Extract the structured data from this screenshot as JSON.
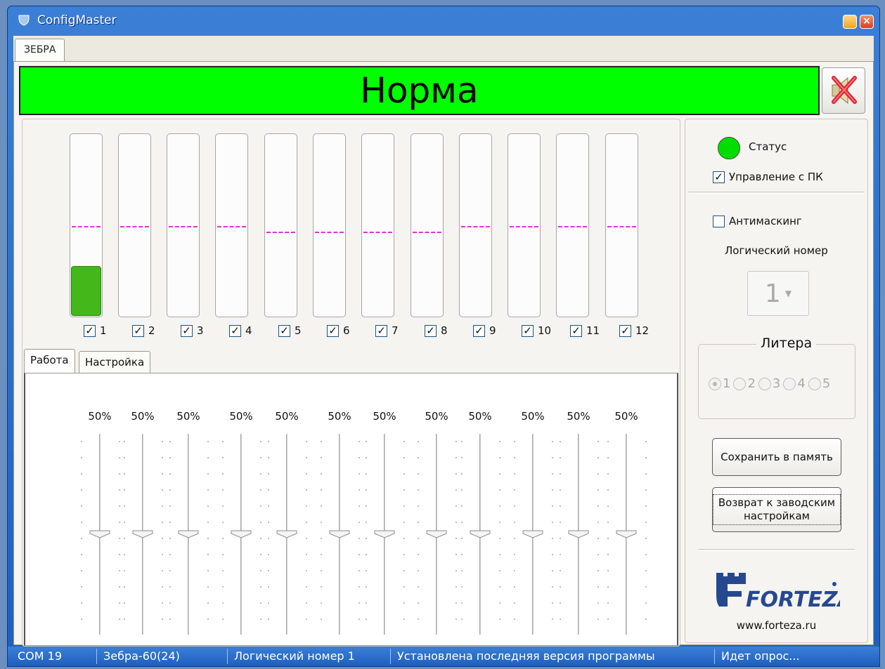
{
  "window": {
    "title": "ConfigMaster"
  },
  "outer_tab": {
    "label": "ЗЕБРА"
  },
  "banner": {
    "status_text": "Норма",
    "color": "#00ff00"
  },
  "channels": [
    {
      "label": "1",
      "checked": true,
      "level": 0.27,
      "threshold": 0.5
    },
    {
      "label": "2",
      "checked": true,
      "level": 0,
      "threshold": 0.5
    },
    {
      "label": "3",
      "checked": true,
      "level": 0,
      "threshold": 0.5
    },
    {
      "label": "4",
      "checked": true,
      "level": 0,
      "threshold": 0.5
    },
    {
      "label": "5",
      "checked": true,
      "level": 0,
      "threshold": 0.47
    },
    {
      "label": "6",
      "checked": true,
      "level": 0,
      "threshold": 0.47
    },
    {
      "label": "7",
      "checked": true,
      "level": 0,
      "threshold": 0.47
    },
    {
      "label": "8",
      "checked": true,
      "level": 0,
      "threshold": 0.47
    },
    {
      "label": "9",
      "checked": true,
      "level": 0,
      "threshold": 0.5
    },
    {
      "label": "10",
      "checked": true,
      "level": 0,
      "threshold": 0.5
    },
    {
      "label": "11",
      "checked": true,
      "level": 0,
      "threshold": 0.5
    },
    {
      "label": "12",
      "checked": true,
      "level": 0,
      "threshold": 0.5
    }
  ],
  "inner_tabs": [
    {
      "label": "Работа",
      "selected": true
    },
    {
      "label": "Настройка",
      "selected": false
    }
  ],
  "sliders": [
    {
      "value_text": "50%",
      "value": 0.5
    },
    {
      "value_text": "50%",
      "value": 0.5
    },
    {
      "value_text": "50%",
      "value": 0.5
    },
    {
      "value_text": "50%",
      "value": 0.5
    },
    {
      "value_text": "50%",
      "value": 0.5
    },
    {
      "value_text": "50%",
      "value": 0.5
    },
    {
      "value_text": "50%",
      "value": 0.5
    },
    {
      "value_text": "50%",
      "value": 0.5
    },
    {
      "value_text": "50%",
      "value": 0.5
    },
    {
      "value_text": "50%",
      "value": 0.5
    },
    {
      "value_text": "50%",
      "value": 0.5
    },
    {
      "value_text": "50%",
      "value": 0.5
    }
  ],
  "right_panel": {
    "status_label": "Статус",
    "status_color": "#00dd00",
    "pc_control_label": "Управление с ПК",
    "pc_control_checked": true,
    "antimasking_label": "Антимаскинг",
    "antimasking_checked": false,
    "logical_number_label": "Логический номер",
    "logical_number_value": "1",
    "litera_title": "Литера",
    "litera_options": [
      "1",
      "2",
      "3",
      "4",
      "5"
    ],
    "litera_selected": "1",
    "save_button": "Сохранить в память",
    "reset_button": "Возврат к заводским настройкам",
    "logo_text": "FORTEZA",
    "website": "www.forteza.ru"
  },
  "statusbar": {
    "port": "COM 19",
    "device": "Зебра-60(24)",
    "logical_number": "Логический номер 1",
    "version_status": "Установлена последняя версия программы",
    "polling": "Идет опрос..."
  }
}
